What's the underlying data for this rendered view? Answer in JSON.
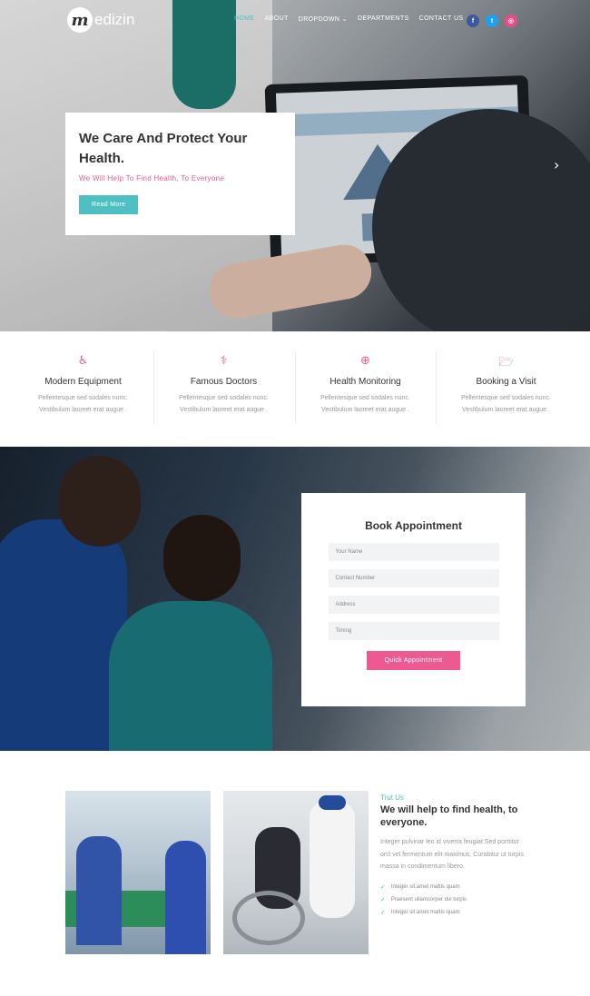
{
  "nav": {
    "logo_mark": "m",
    "logo_text": "edizin",
    "items": [
      "HOME",
      "ABOUT",
      "DROPDOWN",
      "DEPARTMENTS",
      "CONTACT US"
    ],
    "dropdown_caret": "⌄",
    "social": [
      {
        "label": "f",
        "color": "#3b5998",
        "icon": "facebook-icon"
      },
      {
        "label": "t",
        "color": "#1da1f2",
        "icon": "twitter-icon"
      },
      {
        "label": "◎",
        "color": "#ea4c89",
        "icon": "dribbble-icon"
      }
    ]
  },
  "hero": {
    "title": "We Care And Protect Your Health.",
    "subtitle": "We Will Help To Find Health, To Everyone",
    "button": "Read More",
    "next_arrow": "›"
  },
  "features": [
    {
      "icon": "wheelchair-icon",
      "glyph": "♿",
      "title": "Modern Equipment",
      "text1": "Pellentesque sed sodales nunc.",
      "text2": "Vestibulum laoreet erat augue ."
    },
    {
      "icon": "doctor-icon",
      "glyph": "⚕",
      "title": "Famous Doctors",
      "text1": "Pellentesque sed sodales nunc.",
      "text2": "Vestibulum laoreet erat augue ."
    },
    {
      "icon": "lifebuoy-icon",
      "glyph": "⊕",
      "title": "Health Monitoring",
      "text1": "Pellentesque sed sodales nunc.",
      "text2": "Vestibulum laoreet erat augue ."
    },
    {
      "icon": "folder-open-icon",
      "glyph": "🗁",
      "title": "Booking a Visit",
      "text1": "Pellentesque sed sodales nunc.",
      "text2": "Vestibulum laoreet erat augue ."
    }
  ],
  "appointment": {
    "title": "Book Appointment",
    "fields": [
      "Your Name",
      "Contact Number",
      "Address",
      "Timing"
    ],
    "button": "Quick Appointment"
  },
  "about": {
    "eyebrow": "Trut Us",
    "title": "We will help to find health, to everyone.",
    "body": "Integer pulvinar leo id viverra feugiat.Sed porttitor orci vel fermentum elit maximus. Curabitur ut turpis massa in condimentum libero.",
    "checks": [
      "Integer sit amet mattis quam",
      "Praesent ullamcorper dui turpis",
      "Integer sit amet mattis quam"
    ],
    "check_glyph": "✓"
  },
  "colors": {
    "teal": "#4ec0c4",
    "pink": "#ed5a92"
  }
}
